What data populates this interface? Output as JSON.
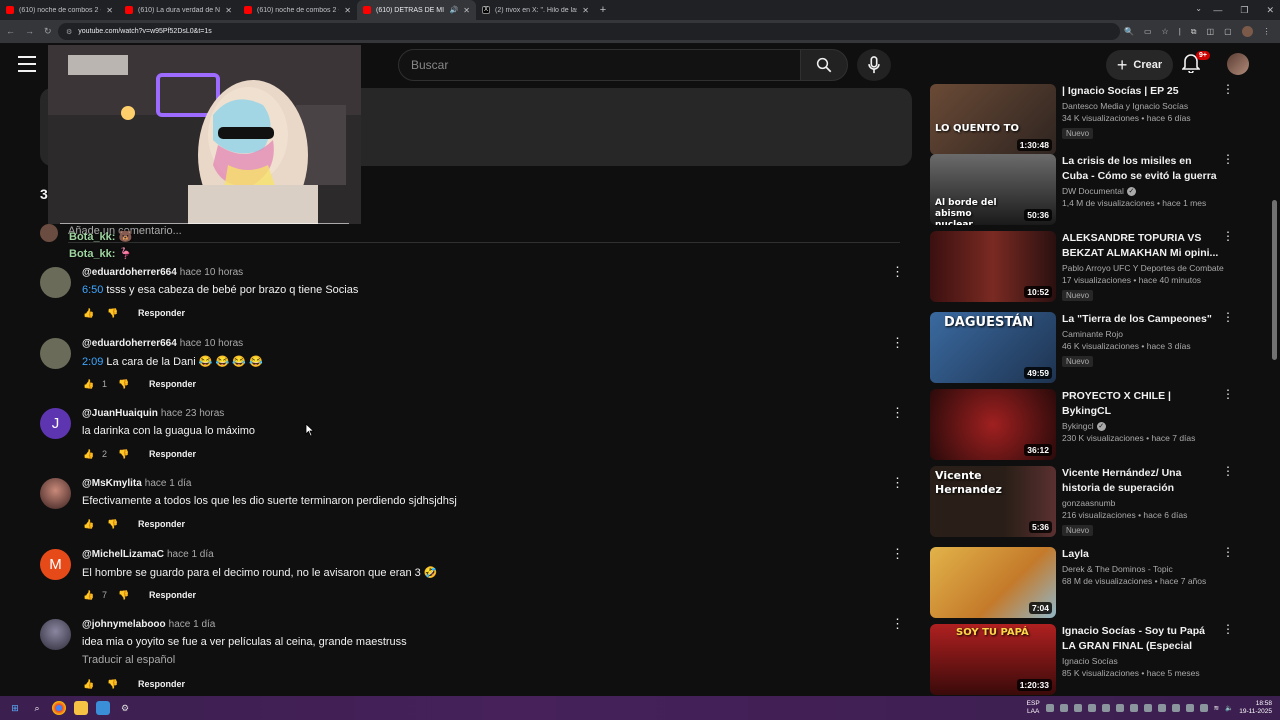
{
  "browser": {
    "tabs": [
      {
        "title": "(610) noche de combos 2 - You",
        "active": false
      },
      {
        "title": "(610) La dura verdad de Noche",
        "active": false
      },
      {
        "title": "(610) noche de combos 2 - You",
        "active": false
      },
      {
        "title": "(610) DETRÁS DE MI DERR...",
        "active": true
      },
      {
        "title": "(2) rivox en X: \". Hilo de las mar",
        "active": false
      }
    ],
    "url": "youtube.com/watch?v=w95Pf52DsL0&t=1s"
  },
  "header": {
    "search_placeholder": "Buscar",
    "create_label": "Crear",
    "notif_count": "9+"
  },
  "comments_section": {
    "count": "3",
    "add_placeholder": "Añade un comentario..."
  },
  "chat_overlay": [
    "Bota_kk:",
    "Bota_kk:"
  ],
  "comments": [
    {
      "author": "@eduardoherrer664",
      "time": "hace 10 horas",
      "timestamp": "6:50",
      "text": "tsss y esa cabeza de bebé por brazo q tiene Socias",
      "likes": "",
      "reply": "Responder",
      "avatar_color": "#6b6b5a",
      "avatar_letter": ""
    },
    {
      "author": "@eduardoherrer664",
      "time": "hace 10 horas",
      "timestamp": "2:09",
      "text": "La cara de la Dani 😂 😂 😂 😂",
      "likes": "1",
      "reply": "Responder",
      "avatar_color": "#6b6b5a",
      "avatar_letter": ""
    },
    {
      "author": "@JuanHuaiquin",
      "time": "hace 23 horas",
      "timestamp": "",
      "text": "la darinka con la guagua lo máximo",
      "likes": "2",
      "reply": "Responder",
      "avatar_color": "#5e35b1",
      "avatar_letter": "J"
    },
    {
      "author": "@MsKmylita",
      "time": "hace 1 día",
      "timestamp": "",
      "text": "Efectivamente a todos los que les dio suerte terminaron perdiendo sjdhsjdhsj",
      "likes": "",
      "reply": "Responder",
      "avatar_color": "#4a2e2e",
      "avatar_letter": ""
    },
    {
      "author": "@MichelLizamaC",
      "time": "hace 1 día",
      "timestamp": "",
      "text": "El hombre se guardo para el decimo round, no le avisaron que eran 3 🤣",
      "likes": "7",
      "reply": "Responder",
      "avatar_color": "#e64a19",
      "avatar_letter": "M"
    },
    {
      "author": "@johnymelabooo",
      "time": "hace 1 día",
      "timestamp": "",
      "text": "idea mia o yoyito se fue a ver películas al ceina, grande maestruss",
      "likes": "",
      "reply": "Responder",
      "avatar_color": "#5a5570",
      "avatar_letter": "",
      "translate": "Traducir al español"
    }
  ],
  "recommendations": [
    {
      "title": "| Ignacio Socías | EP 25",
      "channel": "Dantesco Media y Ignacio Socías",
      "verified": false,
      "views": "34 K visualizaciones • hace 6 días",
      "badge": "Nuevo",
      "duration": "1:30:48",
      "thumb_text": "LO QUENTO TO",
      "thumb_color": "#5a4030"
    },
    {
      "title": "La crisis de los misiles en Cuba - Cómo se evitó la guerra ...",
      "channel": "DW Documental",
      "verified": true,
      "views": "1,4 M de visualizaciones • hace 1 mes",
      "badge": "",
      "duration": "50:36",
      "thumb_text": "Al borde del abismo nuclear",
      "thumb_color": "#2a2a2a"
    },
    {
      "title": "ALEKSANDRE TOPURIA VS BEKZAT ALMAKHAN Mi opini...",
      "channel": "Pablo Arroyo UFC Y Deportes de Combate",
      "verified": false,
      "views": "17 visualizaciones • hace 40 minutos",
      "badge": "Nuevo",
      "duration": "10:52",
      "thumb_text": "",
      "thumb_color": "#5a1e1e"
    },
    {
      "title": "La \"Tierra de los Campeones\"",
      "channel": "Caminante Rojo",
      "verified": false,
      "views": "46 K visualizaciones • hace 3 días",
      "badge": "Nuevo",
      "duration": "49:59",
      "thumb_text": "DAGUESTÁN",
      "thumb_color": "#2b4f7a"
    },
    {
      "title": "PROYECTO X CHILE  | BykingCL",
      "channel": "Bykingcl",
      "verified": true,
      "views": "230 K visualizaciones • hace 7 días",
      "badge": "",
      "duration": "36:12",
      "thumb_text": "",
      "thumb_color": "#4a1515"
    },
    {
      "title": "Vicente Hernández/ Una historia de superación",
      "channel": "gonzaasnumb",
      "verified": false,
      "views": "216 visualizaciones • hace 6 días",
      "badge": "Nuevo",
      "duration": "5:36",
      "thumb_text": "Vicente Hernandez",
      "thumb_color": "#3a2a1a"
    },
    {
      "title": "Layla",
      "channel": "Derek & The Dominos - Topic",
      "verified": false,
      "views": "68 M de visualizaciones • hace 7 años",
      "badge": "",
      "duration": "7:04",
      "thumb_text": "",
      "thumb_color": "#d9a441"
    },
    {
      "title": "Ignacio Socías - Soy tu Papá LA GRAN FINAL (Especial Stand ...",
      "channel": "Ignacio Socías",
      "verified": false,
      "views": "85 K visualizaciones • hace 5 meses",
      "badge": "",
      "duration": "1:20:33",
      "thumb_text": "SOY TU PAPÁ",
      "thumb_color": "#8a1a1a"
    }
  ],
  "taskbar": {
    "lang": "ESP\nLAA",
    "time": "18:58",
    "date": "19-11-2025"
  }
}
